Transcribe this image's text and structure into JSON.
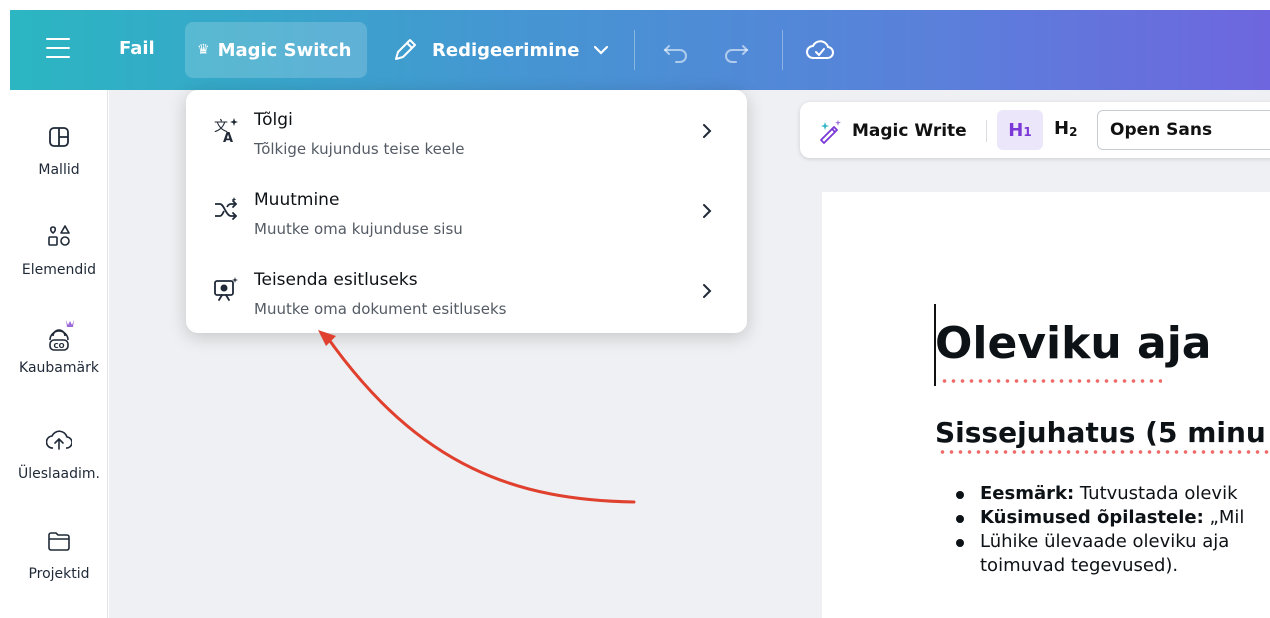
{
  "header": {
    "file_label": "Fail",
    "magic_switch_label": "Magic Switch",
    "edit_label": "Redigeerimine"
  },
  "sidebar": {
    "items": [
      {
        "label": "Mallid",
        "icon": "template-icon"
      },
      {
        "label": "Elemendid",
        "icon": "elements-icon"
      },
      {
        "label": "Kaubamärk",
        "icon": "brand-icon"
      },
      {
        "label": "Üleslaadim.",
        "icon": "upload-icon"
      },
      {
        "label": "Projektid",
        "icon": "folder-icon"
      }
    ]
  },
  "menu": {
    "items": [
      {
        "title": "Tõlgi",
        "subtitle": "Tõlkige kujundus teise keele",
        "icon": "translate-icon"
      },
      {
        "title": "Muutmine",
        "subtitle": "Muutke oma kujunduse sisu",
        "icon": "shuffle-icon"
      },
      {
        "title": "Teisenda esitluseks",
        "subtitle": "Muutke oma dokument esitluseks",
        "icon": "presentation-icon"
      }
    ]
  },
  "toolbar": {
    "magic_write_label": "Magic Write",
    "h1_label": "H",
    "h1_sub": "1",
    "h2_label": "H",
    "h2_sub": "2",
    "font_name": "Open Sans"
  },
  "document": {
    "title": "Oleviku aja",
    "heading": "Sissejuhatus (5 minu",
    "bullets": [
      {
        "bold": "Eesmärk:",
        "text": " Tutvustada olevik"
      },
      {
        "bold": "Küsimused õpilastele:",
        "text": " „Mil"
      },
      {
        "bold": "",
        "text": "Lühike ülevaade oleviku aja"
      },
      {
        "bold": "",
        "text": "toimuvad tegevused)."
      }
    ]
  },
  "colors": {
    "header_start": "#2bb6c2",
    "header_end": "#6e66de",
    "h1_active_bg": "#ece6fb",
    "annotation_arrow": "#e0412e"
  }
}
